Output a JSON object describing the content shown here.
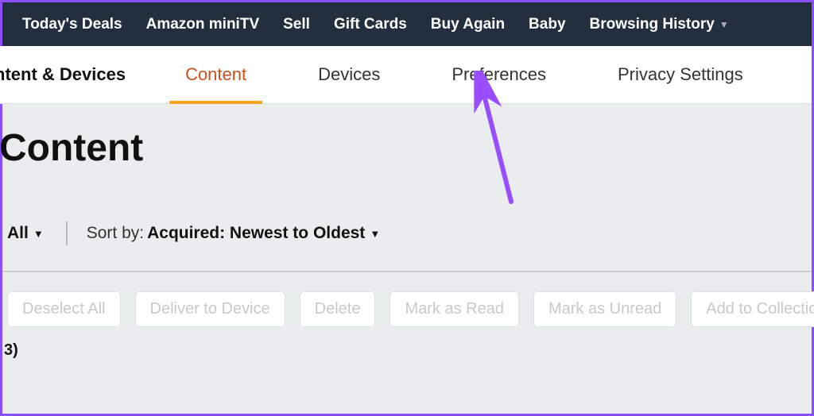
{
  "topnav": {
    "items": [
      {
        "label": "Today's Deals"
      },
      {
        "label": "Amazon miniTV"
      },
      {
        "label": "Sell"
      },
      {
        "label": "Gift Cards"
      },
      {
        "label": "Buy Again"
      },
      {
        "label": "Baby"
      },
      {
        "label": "Browsing History",
        "hasDropdown": true
      }
    ]
  },
  "tabbar": {
    "title": "ntent & Devices",
    "tabs": [
      {
        "label": "Content",
        "active": true
      },
      {
        "label": "Devices"
      },
      {
        "label": "Preferences"
      },
      {
        "label": "Privacy Settings"
      }
    ]
  },
  "page": {
    "title": "Content",
    "filter_all": "All",
    "sort_label": "Sort by:",
    "sort_value": "Acquired: Newest to Oldest",
    "count_fragment": "3)"
  },
  "actions": {
    "deselect": "Deselect All",
    "deliver": "Deliver to Device",
    "delete": "Delete",
    "mark_read": "Mark as Read",
    "mark_unread": "Mark as Unread",
    "add_collection": "Add to Collection"
  },
  "annotation": {
    "arrow_color": "#9a4dff"
  }
}
